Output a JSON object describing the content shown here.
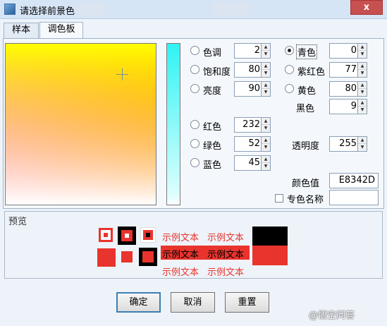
{
  "window": {
    "title": "请选择前景色",
    "close_label": "x"
  },
  "tabs": [
    {
      "label": "样本",
      "active": false
    },
    {
      "label": "调色板",
      "active": true
    }
  ],
  "palette": {
    "current_color": "#E8342D",
    "left_fields": [
      {
        "label": "色调",
        "value": "2",
        "checked": false
      },
      {
        "label": "饱和度",
        "value": "80",
        "checked": false
      },
      {
        "label": "亮度",
        "value": "90",
        "checked": false
      },
      {
        "label": "红色",
        "value": "232",
        "checked": false
      },
      {
        "label": "绿色",
        "value": "52",
        "checked": false
      },
      {
        "label": "蓝色",
        "value": "45",
        "checked": false
      }
    ],
    "right_fields": [
      {
        "label": "青色",
        "value": "0",
        "checked": true
      },
      {
        "label": "紫红色",
        "value": "77",
        "checked": false
      },
      {
        "label": "黄色",
        "value": "80",
        "checked": false
      },
      {
        "label": "黑色",
        "value": "9"
      }
    ],
    "alpha_label": "透明度",
    "alpha_value": "255",
    "hex_label": "颜色值",
    "hex_value": "E8342D",
    "color_name_label": "专色名称",
    "color_name_checked": false,
    "color_name_value": ""
  },
  "preview": {
    "title": "预览",
    "sample_text": "示例文本",
    "color": "#E8342D"
  },
  "buttons": {
    "ok": "确定",
    "cancel": "取消",
    "reset": "重置"
  },
  "watermark": "@悟空问答"
}
